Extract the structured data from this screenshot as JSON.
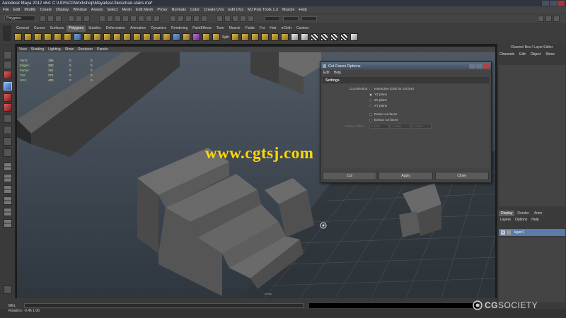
{
  "window": {
    "title": "Autodesk Maya 2012 x64: C:\\UDS\\CGWorkshop\\Maya\\test-files\\chair-stairs.ma*"
  },
  "menubar": {
    "items": [
      "File",
      "Edit",
      "Modify",
      "Create",
      "Display",
      "Window",
      "Assets",
      "Select",
      "Mesh",
      "Edit Mesh",
      "Proxy",
      "Normals",
      "Color",
      "Create UVs",
      "Edit UVs",
      "MJ Poly Tools 1.3",
      "Muscle",
      "Help"
    ]
  },
  "statusline": {
    "mode": "Polygons",
    "accent_color": "#ffd800"
  },
  "shelf": {
    "tabs": [
      "General",
      "Curves",
      "Surfaces",
      "Polygons",
      "Subdivs",
      "Deformation",
      "Animation",
      "Dynamics",
      "Rendering",
      "PaintEffects",
      "Toon",
      "Muscle",
      "Fluids",
      "Fur",
      "Hair",
      "nCloth",
      "Custom"
    ],
    "active_tab": "Polygons",
    "split_label": "Split"
  },
  "viewport": {
    "menu": [
      "View",
      "Shading",
      "Lighting",
      "Show",
      "Renderer",
      "Panels"
    ],
    "hud": [
      {
        "label": "Verts:",
        "values": [
          "196",
          "0",
          "0"
        ]
      },
      {
        "label": "Edges:",
        "values": [
          "380",
          "0",
          "0"
        ]
      },
      {
        "label": "Faces:",
        "values": [
          "191",
          "0",
          "0"
        ]
      },
      {
        "label": "Tris:",
        "values": [
          "374",
          "0",
          "0"
        ]
      },
      {
        "label": "UVs:",
        "values": [
          "400",
          "0",
          "0"
        ]
      }
    ],
    "camera_label": "persp",
    "watermark": "www.cgtsj.com"
  },
  "dialog": {
    "title": "Cut Faces Options",
    "menu": [
      "Edit",
      "Help"
    ],
    "section": "Settings",
    "cut_direction_label": "Cut direction:",
    "options": [
      {
        "label": "Interactive (click for cut line)",
        "selected": false
      },
      {
        "label": "YZ plane",
        "selected": true
      },
      {
        "label": "ZX plane",
        "selected": false
      },
      {
        "label": "XY plane",
        "selected": false
      }
    ],
    "checks": [
      {
        "label": "Delete cut faces",
        "checked": false
      },
      {
        "label": "Extract cut faces",
        "checked": false
      }
    ],
    "extract_offset_label": "Extract offset:",
    "extract_offset_values": [
      "0.0000",
      "0.0000",
      "0.0000"
    ],
    "buttons": {
      "cut": "Cut",
      "apply": "Apply",
      "close": "Close"
    }
  },
  "rightpanel": {
    "title": "Channel Box / Layer Editor",
    "menu": [
      "Channels",
      "Edit",
      "Object",
      "Show"
    ],
    "layer_tabs": [
      "Display",
      "Render",
      "Anim"
    ],
    "active_layer_tab": "Display",
    "layer_menu": [
      "Layers",
      "Options",
      "Help"
    ],
    "layer": {
      "visible": "V",
      "name": "layer1"
    }
  },
  "bottom": {
    "mel_label": "MEL",
    "help_text": "Rotation: -0.46   1.06"
  },
  "branding": {
    "logo_bold": "CG",
    "logo_light": "SOCIETY"
  }
}
